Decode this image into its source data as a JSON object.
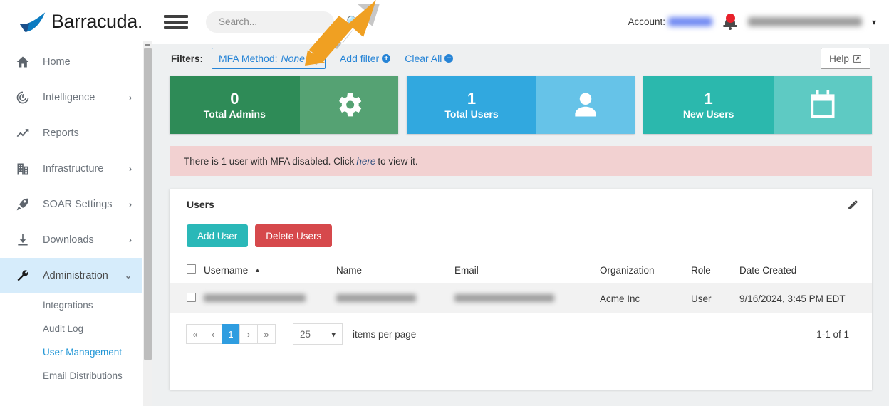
{
  "brand": {
    "name": "Barracuda."
  },
  "topbar": {
    "search_placeholder": "Search...",
    "search_value": "",
    "account_label": "Account:",
    "account_value_redacted": true,
    "user_name_redacted": true,
    "menu_icon": "hamburger-icon",
    "search_icon": "search-icon",
    "notification_icon": "bell-icon",
    "caret": "▾"
  },
  "sidebar": {
    "items": [
      {
        "label": "Home",
        "icon": "home-icon",
        "expandable": false,
        "active": false
      },
      {
        "label": "Intelligence",
        "icon": "target-icon",
        "expandable": true,
        "active": false,
        "chevron": "›"
      },
      {
        "label": "Reports",
        "icon": "trend-up-icon",
        "expandable": false,
        "active": false
      },
      {
        "label": "Infrastructure",
        "icon": "building-icon",
        "expandable": true,
        "active": false,
        "chevron": "›"
      },
      {
        "label": "SOAR Settings",
        "icon": "rocket-icon",
        "expandable": true,
        "active": false,
        "chevron": "›"
      },
      {
        "label": "Downloads",
        "icon": "download-icon",
        "expandable": true,
        "active": false,
        "chevron": "›"
      },
      {
        "label": "Administration",
        "icon": "wrench-icon",
        "expandable": true,
        "active": true,
        "chevron": "⌄"
      }
    ],
    "subitems": [
      {
        "label": "Integrations",
        "selected": false
      },
      {
        "label": "Audit Log",
        "selected": false
      },
      {
        "label": "User Management",
        "selected": true
      },
      {
        "label": "Email Distributions",
        "selected": false
      }
    ]
  },
  "filters": {
    "label": "Filters:",
    "chip": {
      "name": "MFA Method:",
      "value": "None",
      "edit_icon": "pencil-icon"
    },
    "add_filter": {
      "label": "Add filter",
      "icon": "plus-circle-icon",
      "glyph": "+"
    },
    "clear_all": {
      "label": "Clear All",
      "icon": "minus-circle-icon",
      "glyph": "−"
    },
    "help": {
      "label": "Help",
      "icon": "external-link-icon"
    }
  },
  "stat_cards": [
    {
      "value": "0",
      "caption": "Total Admins",
      "icon": "gear-icon",
      "color": "#2e8b57",
      "icon_bg": "#55a273"
    },
    {
      "value": "1",
      "caption": "Total Users",
      "icon": "person-icon",
      "color": "#31a8df",
      "icon_bg": "#66c3e8"
    },
    {
      "value": "1",
      "caption": "New Users",
      "icon": "calendar-icon",
      "color": "#2bb8ad",
      "icon_bg": "#5ecac3"
    }
  ],
  "alert": {
    "text_before": "There is 1 user with MFA disabled. Click",
    "link": "here",
    "text_after": "to view it."
  },
  "panel": {
    "title": "Users",
    "edit_icon": "pencil-icon",
    "add_button": "Add User",
    "delete_button": "Delete Users",
    "columns": [
      {
        "label": "Username",
        "sorted": true,
        "sort_dir": "▲"
      },
      {
        "label": "Name"
      },
      {
        "label": "Email"
      },
      {
        "label": "Organization"
      },
      {
        "label": "Role"
      },
      {
        "label": "Date Created"
      }
    ],
    "rows": [
      {
        "username_redacted": true,
        "name_redacted": true,
        "email_redacted": true,
        "organization": "Acme Inc",
        "role": "User",
        "date_created": "9/16/2024, 3:45 PM EDT"
      }
    ]
  },
  "pagination": {
    "first": "«",
    "prev": "‹",
    "current_page": "1",
    "next": "›",
    "last": "»",
    "items_per_page_value": "25",
    "items_per_page_label": "items per page",
    "range": "1-1 of 1"
  },
  "annotation": {
    "type": "arrow",
    "color": "#f0a022",
    "points_to": "mfa-method-filter-chip"
  },
  "colors": {
    "brand_blue": "#0b7bc1",
    "link_blue": "#2684d6",
    "accent_teal": "#2ab8b8",
    "danger_red": "#d6494c",
    "alert_bg": "#f2d1d1",
    "page_bg": "#eef0f1",
    "active_nav": "#d6ecfb"
  }
}
